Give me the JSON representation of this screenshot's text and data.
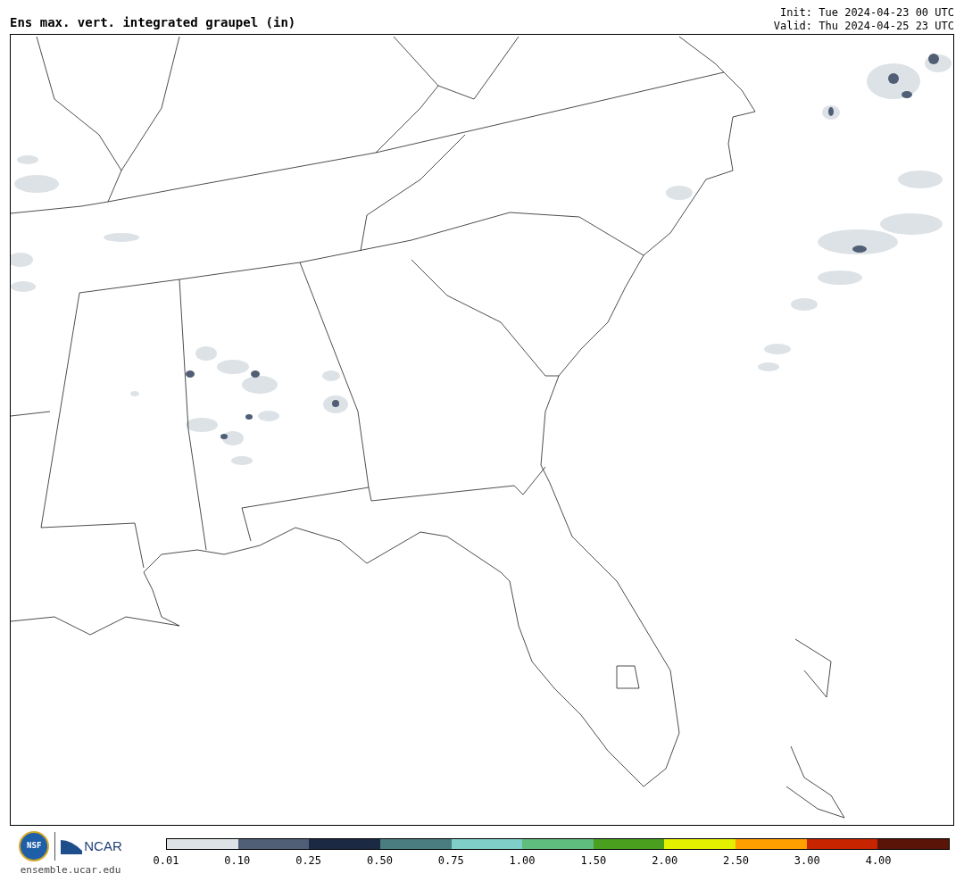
{
  "title": "Ens max. vert. integrated graupel (in)",
  "init": "Init: Tue 2024-04-23 00 UTC",
  "valid": "Valid: Thu 2024-04-25 23 UTC",
  "logo": {
    "nsf": "NSF",
    "ncar": "NCAR",
    "url": "ensemble.ucar.edu"
  },
  "colorbar": [
    {
      "color": "#dde2e6",
      "label": "0.01"
    },
    {
      "color": "#505f75",
      "label": "0.10"
    },
    {
      "color": "#1b2a42",
      "label": "0.25"
    },
    {
      "color": "#4a7d80",
      "label": "0.50"
    },
    {
      "color": "#7fcfc8",
      "label": "0.75"
    },
    {
      "color": "#5fbd7d",
      "label": "1.00"
    },
    {
      "color": "#4aa01e",
      "label": "1.50"
    },
    {
      "color": "#e3f000",
      "label": "2.00"
    },
    {
      "color": "#ff9f00",
      "label": "2.50"
    },
    {
      "color": "#c82400",
      "label": "3.00"
    },
    {
      "color": "#5a1408",
      "label": "4.00"
    }
  ]
}
